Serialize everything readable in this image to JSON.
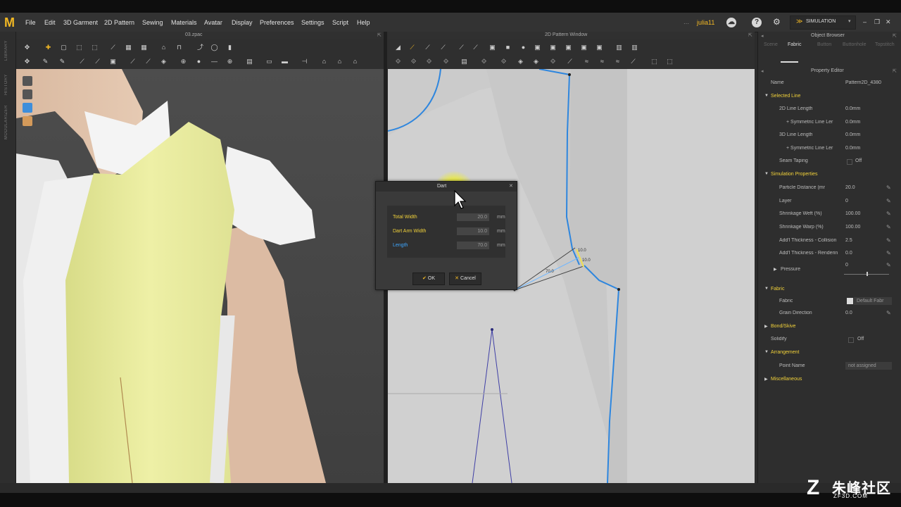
{
  "app": {
    "logo": "M"
  },
  "menu": [
    "File",
    "Edit",
    "3D Garment",
    "2D Pattern",
    "Sewing",
    "Materials",
    "Avatar",
    "Display",
    "Preferences",
    "Settings",
    "Script",
    "Help"
  ],
  "user": "julia11",
  "simulation": {
    "label": "SIMULATION"
  },
  "panels": {
    "left_title": "03.zpac",
    "right_title": "2D Pattern Window"
  },
  "left_rail": [
    "LIBRARY",
    "HISTORY",
    "MODULARIZER"
  ],
  "dialog": {
    "title": "Dart",
    "fields": [
      {
        "label": "Total Width",
        "value": "20.0",
        "unit": "mm"
      },
      {
        "label": "Dart Arm Width",
        "value": "10.0",
        "unit": "mm"
      },
      {
        "label": "Length",
        "value": "70.0",
        "unit": "mm"
      }
    ],
    "ok_label": "OK",
    "cancel_label": "Cancel"
  },
  "pattern_labels": {
    "a": "10.0",
    "b": "10.0",
    "c": "70.0"
  },
  "object_browser": {
    "title": "Object Browser",
    "tabs": [
      "Scene",
      "Fabric",
      "Button",
      "Buttonhole",
      "Topstitch"
    ],
    "active_tab": "Fabric"
  },
  "property_editor": {
    "title": "Property Editor",
    "name_label": "Name",
    "name_value": "Pattern2D_4380",
    "selected_line": "Selected Line",
    "line_2d": "2D Line Length",
    "line_2d_val": "0.0mm",
    "sym1": "+ Symmetric Line Ler",
    "sym1_val": "0.0mm",
    "line_3d": "3D Line Length",
    "line_3d_val": "0.0mm",
    "sym2": "+ Symmetric Line Ler",
    "sym2_val": "0.0mm",
    "seam_taping": "Seam Taping",
    "seam_taping_val": "Off",
    "sim_props": "Simulation Properties",
    "particle": "Particle Distance (mr",
    "particle_val": "20.0",
    "layer": "Layer",
    "layer_val": "0",
    "weft": "Shrinkage Weft (%)",
    "weft_val": "100.00",
    "warp": "Shrinkage Warp (%)",
    "warp_val": "100.00",
    "thick_col": "Add'l Thickness - Collision",
    "thick_col_val": "2.5",
    "thick_ren": "Add'l Thickness - Renderin",
    "thick_ren_val": "0.0",
    "pressure": "Pressure",
    "pressure_val": "0",
    "fabric_sec": "Fabric",
    "fabric": "Fabric",
    "fabric_val": "Default Fabr",
    "grain": "Grain Direction",
    "grain_val": "0.0",
    "bond": "Bond/Skive",
    "solidify": "Solidify",
    "solidify_val": "Off",
    "arrangement": "Arrangement",
    "point_name": "Point Name",
    "point_name_val": "not assigned",
    "misc": "Miscellaneous"
  },
  "watermark": {
    "main": "朱峰社区",
    "sub": "ZF3D.COM",
    "logo": "Z"
  },
  "colors": {
    "accent": "#f2b824",
    "pattern_line": "#3a8fe0",
    "garment_yellow": "#ecee9e"
  }
}
